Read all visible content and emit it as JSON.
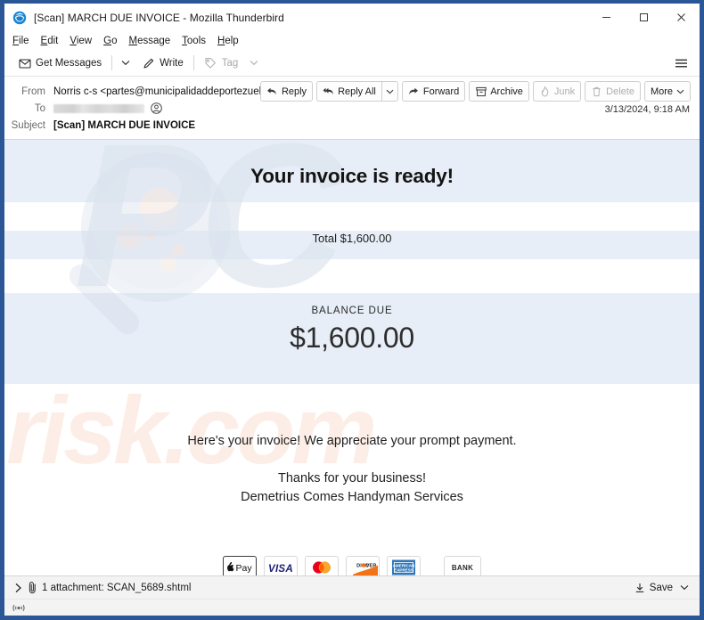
{
  "window": {
    "title": "[Scan] MARCH DUE INVOICE - Mozilla Thunderbird",
    "logo_icon": "thunderbird-logo-icon",
    "minimize_label": "─",
    "maximize_label": "□",
    "close_label": "✕",
    "accent_color": "#2b5797"
  },
  "menubar": {
    "items": [
      {
        "label": "File",
        "accel": "F"
      },
      {
        "label": "Edit",
        "accel": "E"
      },
      {
        "label": "View",
        "accel": "V"
      },
      {
        "label": "Go",
        "accel": "G"
      },
      {
        "label": "Message",
        "accel": "M"
      },
      {
        "label": "Tools",
        "accel": "T"
      },
      {
        "label": "Help",
        "accel": "H"
      }
    ]
  },
  "toolbar": {
    "get_messages_label": "Get Messages",
    "get_messages_icon": "inbox-download-icon",
    "get_messages_caret_icon": "chevron-down-icon",
    "write_label": "Write",
    "write_icon": "pencil-icon",
    "tag_label": "Tag",
    "tag_icon": "tag-icon",
    "tag_caret_icon": "chevron-down-icon",
    "tag_disabled": true,
    "hamburger_icon": "hamburger-menu-icon"
  },
  "message_header": {
    "from_label": "From",
    "from_value": "Norris c-s <partes@municipalidaddeportezuelo.cl>",
    "from_contact_icon": "contact-avatar-icon",
    "to_label": "To",
    "to_value": "",
    "to_redacted": true,
    "to_contact_icon": "contact-avatar-icon",
    "subject_label": "Subject",
    "subject_value": "[Scan] MARCH DUE INVOICE",
    "date": "3/13/2024, 9:18 AM",
    "actions": [
      {
        "label": "Reply",
        "icon": "reply-arrow-icon",
        "disabled": false
      },
      {
        "label": "Reply All",
        "icon": "reply-all-arrow-icon",
        "disabled": false
      },
      {
        "label": "Forward",
        "icon": "forward-arrow-icon",
        "disabled": false
      },
      {
        "label": "Archive",
        "icon": "archive-box-icon",
        "disabled": false
      },
      {
        "label": "Junk",
        "icon": "junk-fire-icon",
        "disabled": true
      },
      {
        "label": "Delete",
        "icon": "trash-can-icon",
        "disabled": true
      },
      {
        "label": "More",
        "icon": "chevron-down-icon",
        "disabled": false
      }
    ],
    "reply_all_caret_icon": "chevron-down-icon"
  },
  "email_body": {
    "headline": "Your invoice is ready!",
    "total_line": "Total $1,600.00",
    "balance_label": "BALANCE DUE",
    "balance_amount": "$1,600.00",
    "message_line_1": "Here's your invoice! We appreciate your prompt payment.",
    "message_line_2": "Thanks for your business!",
    "message_line_3": "Demetrius Comes Handyman Services",
    "band_color": "#e8eef7",
    "payment_methods": [
      {
        "name": "Apple Pay",
        "icon": "apple-pay-icon"
      },
      {
        "name": "VISA",
        "icon": "visa-icon"
      },
      {
        "name": "Mastercard",
        "icon": "mastercard-icon"
      },
      {
        "name": "DISCOVER",
        "icon": "discover-icon"
      },
      {
        "name": "American Express",
        "icon": "amex-icon"
      },
      {
        "name": "BANK",
        "icon": "bank-icon",
        "label": "BANK"
      }
    ],
    "watermark_primary": "PC",
    "watermark_secondary": "risk.com"
  },
  "attachment_bar": {
    "twisty_icon": "chevron-right-icon",
    "paperclip_icon": "paperclip-icon",
    "text": "1 attachment: SCAN_5689.shtml",
    "save_label": "Save",
    "save_icon": "download-icon",
    "save_caret_icon": "chevron-down-icon"
  },
  "status_bar": {
    "connection_icon": "online-status-icon",
    "connection_glyph": "((•))"
  }
}
